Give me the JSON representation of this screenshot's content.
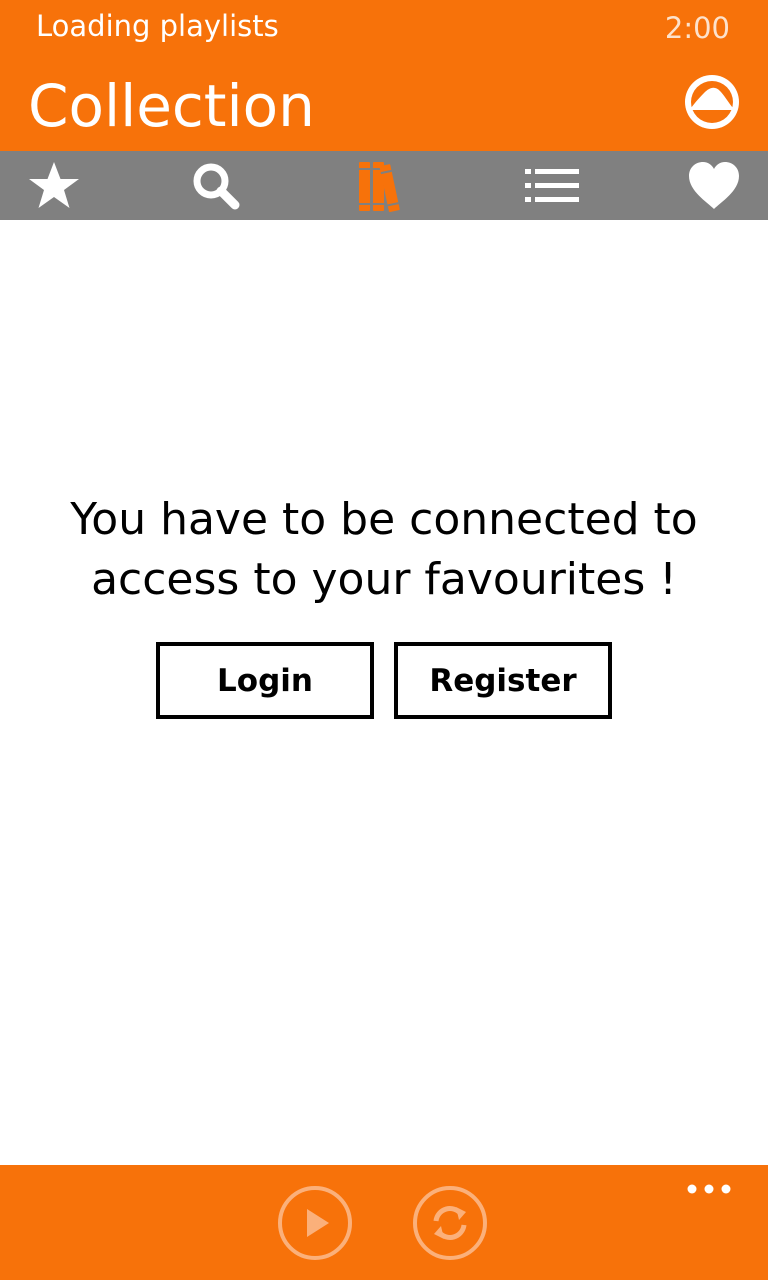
{
  "status": {
    "text": "Loading playlists",
    "time": "2:00"
  },
  "header": {
    "title": "Collection",
    "logo_icon": "grooveshark-logo-icon"
  },
  "tabs": [
    {
      "icon": "star-icon",
      "active": false
    },
    {
      "icon": "search-icon",
      "active": false
    },
    {
      "icon": "books-collection-icon",
      "active": true
    },
    {
      "icon": "list-icon",
      "active": false
    },
    {
      "icon": "heart-icon",
      "active": false
    }
  ],
  "main": {
    "message_line1": "You have to be connected to",
    "message_line2": "access to your favourites !",
    "login_label": "Login",
    "register_label": "Register"
  },
  "appbar": {
    "buttons": [
      {
        "icon": "play-icon"
      },
      {
        "icon": "repeat-icon"
      }
    ],
    "more_icon": "ellipsis-icon"
  },
  "colors": {
    "accent": "#f7720a",
    "tabbar": "#808080",
    "background": "#ffffff",
    "text": "#000000"
  }
}
